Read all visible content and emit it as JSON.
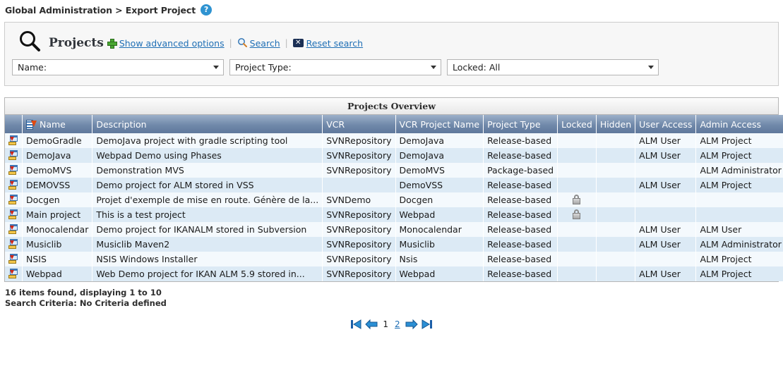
{
  "breadcrumb": {
    "text": "Global Administration > Export Project",
    "help_icon": "help-circle-icon",
    "help_glyph": "?"
  },
  "search_panel": {
    "heading": "Projects",
    "magnifier_icon": "search-magnifier-icon",
    "links": [
      {
        "label": "Show advanced options",
        "icon": "plus-icon"
      },
      {
        "label": "Search",
        "icon": "search-icon"
      },
      {
        "label": "Reset search",
        "icon": "reset-x-icon"
      }
    ],
    "separator": "|",
    "filters": [
      {
        "name": "name-filter",
        "value": "Name:"
      },
      {
        "name": "project-type-filter",
        "value": "Project Type:"
      },
      {
        "name": "locked-filter",
        "value": "Locked: All"
      }
    ]
  },
  "overview": {
    "title": "Projects Overview",
    "sort_icon": "sort-descending-icon",
    "row_icon": "export-project-icon",
    "lock_icon": "locked-padlock-icon",
    "columns": [
      "Name",
      "Description",
      "VCR",
      "VCR Project Name",
      "Project Type",
      "Locked",
      "Hidden",
      "User Access",
      "Admin Access"
    ],
    "rows": [
      {
        "name": "DemoGradle",
        "description": "DemoJava project with gradle scripting tool",
        "vcr": "SVNRepository",
        "vcr_project_name": "DemoJava",
        "project_type": "Release-based",
        "locked": false,
        "hidden": "",
        "user_access": "ALM User",
        "admin_access": "ALM Project"
      },
      {
        "name": "DemoJava",
        "description": "Webpad Demo using Phases",
        "vcr": "SVNRepository",
        "vcr_project_name": "DemoJava",
        "project_type": "Release-based",
        "locked": false,
        "hidden": "",
        "user_access": "ALM User",
        "admin_access": "ALM Project"
      },
      {
        "name": "DemoMVS",
        "description": "Demonstration MVS",
        "vcr": "SVNRepository",
        "vcr_project_name": "DemoMVS",
        "project_type": "Package-based",
        "locked": false,
        "hidden": "",
        "user_access": "",
        "admin_access": "ALM Administrator"
      },
      {
        "name": "DEMOVSS",
        "description": "Demo project for ALM stored in VSS",
        "vcr": "",
        "vcr_project_name": "DemoVSS",
        "project_type": "Release-based",
        "locked": false,
        "hidden": "",
        "user_access": "ALM User",
        "admin_access": "ALM Project"
      },
      {
        "name": "Docgen",
        "description": "Projet d'exemple de mise en route. Génère de la...",
        "vcr": "SVNDemo",
        "vcr_project_name": "Docgen",
        "project_type": "Release-based",
        "locked": true,
        "hidden": "",
        "user_access": "",
        "admin_access": ""
      },
      {
        "name": "Main project",
        "description": "This is a test project",
        "vcr": "SVNRepository",
        "vcr_project_name": "Webpad",
        "project_type": "Release-based",
        "locked": true,
        "hidden": "",
        "user_access": "",
        "admin_access": ""
      },
      {
        "name": "Monocalendar",
        "description": "Demo project for IKANALM stored in Subversion",
        "vcr": "SVNRepository",
        "vcr_project_name": "Monocalendar",
        "project_type": "Release-based",
        "locked": false,
        "hidden": "",
        "user_access": "ALM User",
        "admin_access": "ALM User"
      },
      {
        "name": "Musiclib",
        "description": "Musiclib Maven2",
        "vcr": "SVNRepository",
        "vcr_project_name": "Musiclib",
        "project_type": "Release-based",
        "locked": false,
        "hidden": "",
        "user_access": "ALM User",
        "admin_access": "ALM Administrator"
      },
      {
        "name": "NSIS",
        "description": "NSIS Windows Installer",
        "vcr": "SVNRepository",
        "vcr_project_name": "Nsis",
        "project_type": "Release-based",
        "locked": false,
        "hidden": "",
        "user_access": "",
        "admin_access": "ALM Project"
      },
      {
        "name": "Webpad",
        "description": "Web Demo project for IKAN ALM 5.9 stored in...",
        "vcr": "SVNRepository",
        "vcr_project_name": "Webpad",
        "project_type": "Release-based",
        "locked": false,
        "hidden": "",
        "user_access": "ALM User",
        "admin_access": "ALM Project"
      }
    ]
  },
  "footer": {
    "items_found": "16 items found, displaying 1 to 10",
    "search_criteria": "Search Criteria: No Criteria defined",
    "pagination": {
      "first_icon": "first-page-icon",
      "prev_icon": "previous-page-icon",
      "next_icon": "next-page-icon",
      "last_icon": "last-page-icon",
      "pages": [
        {
          "label": "1",
          "current": true
        },
        {
          "label": "2",
          "current": false
        }
      ]
    }
  },
  "colors": {
    "link": "#1f6fb5",
    "header_gradient_top": "#9db0c9",
    "header_gradient_bottom": "#5f789c",
    "row_odd": "#f4f9fd",
    "row_even": "#dceaf5",
    "help_blue": "#2f93d1"
  }
}
